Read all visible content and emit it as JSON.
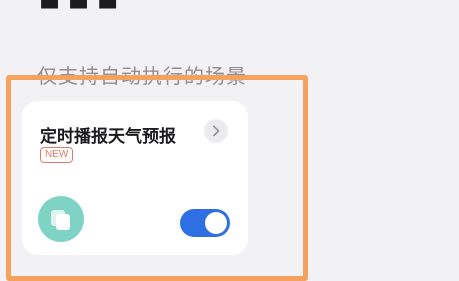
{
  "section": {
    "label": "仅支持自动执行的场景"
  },
  "scene_card": {
    "title": "定时播报天气预报",
    "badge": "NEW",
    "toggle_on": true
  },
  "icons": {
    "detail": "chevron-right-icon",
    "scene": "copy-icon"
  },
  "colors": {
    "highlight_border": "#f5a25e",
    "toggle_active": "#2f6fe4",
    "scene_icon_bg": "#7fd3c5",
    "badge": "#e57865"
  }
}
